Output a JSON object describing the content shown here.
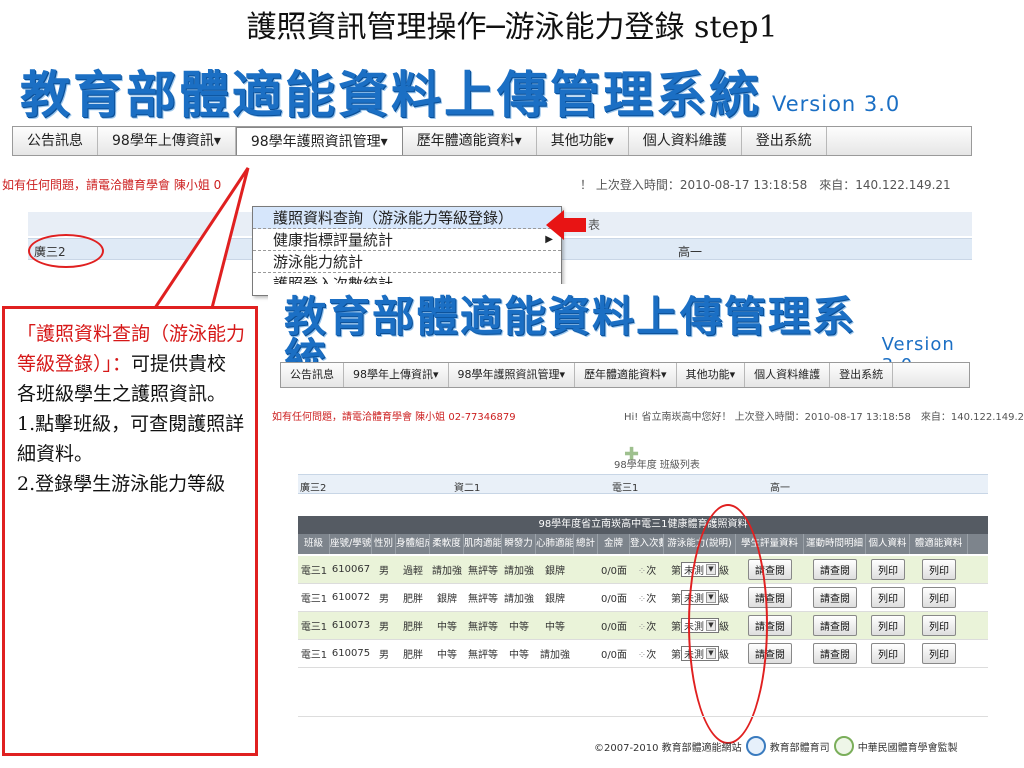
{
  "slide": {
    "title": "護照資訊管理操作─游泳能力登錄 step1"
  },
  "system": {
    "title": "教育部體適能資料上傳管理系統",
    "version": "Version 3.0",
    "nav": [
      "公告訊息",
      "98學年上傳資訊▾",
      "98學年護照資訊管理▾",
      "歷年體適能資料▾",
      "其他功能▾",
      "個人資料維護",
      "登出系統"
    ],
    "contact": "如有任何問題，請電洽體育學會 陳小姐 02-77346879",
    "contact_top": "如有任何問題，請電洽體育學會 陳小姐 0",
    "greeting_top": "！ 上次登入時間：2010-08-17 13:18:58　來自：140.122.149.21",
    "greeting": "Hi! 省立南崁高中您好！ 上次登入時間：2010-08-17 13:18:58　來自：140.122.149.21"
  },
  "dropdown": {
    "items": [
      "護照資料查詢（游泳能力等級登錄）",
      "健康指標評量統計",
      "游泳能力統計",
      "護照登入次數統計"
    ]
  },
  "top_list": {
    "header_tail": "表",
    "row": [
      "廣三2",
      "高一"
    ]
  },
  "callout": {
    "red_text": "「護照資料查詢（游泳能力等級登錄）」：",
    "text": "可提供貴校各班級學生之護照資訊。",
    "step1": "1.點擊班級，可查閱護照詳細資料。",
    "step2": "2.登錄學生游泳能力等級"
  },
  "class_list": {
    "title": "98學年度 班級列表",
    "classes": [
      "廣三2",
      "資二1",
      "電三1",
      "高一"
    ]
  },
  "table": {
    "caption": "98學年度省立南崁高中電三1健康體育護照資料",
    "headers": [
      "班級",
      "座號/學號",
      "性別",
      "身體組成",
      "柔軟度",
      "肌肉適能",
      "瞬發力",
      "心肺適能",
      "總計",
      "金牌",
      "登入次數",
      "游泳能力(說明)",
      "學生評量資料",
      "運動時間明細",
      "個人資料",
      "體適能資料"
    ],
    "rows": [
      [
        "電三1",
        "610067",
        "男",
        "過輕",
        "請加強",
        "無評等",
        "請加強",
        "銀牌",
        "0/0面",
        "次",
        "未測",
        "請查閱",
        "請查閱",
        "列印",
        "列印"
      ],
      [
        "電三1",
        "610072",
        "男",
        "肥胖",
        "銀牌",
        "無評等",
        "請加強",
        "銀牌",
        "0/0面",
        "次",
        "未測",
        "請查閱",
        "請查閱",
        "列印",
        "列印"
      ],
      [
        "電三1",
        "610073",
        "男",
        "肥胖",
        "中等",
        "無評等",
        "中等",
        "中等",
        "0/0面",
        "次",
        "未測",
        "請查閱",
        "請查閱",
        "列印",
        "列印"
      ],
      [
        "電三1",
        "610075",
        "男",
        "肥胖",
        "中等",
        "無評等",
        "中等",
        "請加強",
        "0/0面",
        "次",
        "未測",
        "請查閱",
        "請查閱",
        "列印",
        "列印"
      ]
    ],
    "swim_prefix": "第",
    "swim_suffix": "級"
  },
  "footer": {
    "copyright": "©2007-2010 教育部體適能網站",
    "org1": "教育部體育司",
    "org2": "中華民國體育學會監製"
  },
  "colors": {
    "banner_blue": "#1b6fc4",
    "highlight_red": "#e02020",
    "row_green": "#eaf3d9"
  }
}
